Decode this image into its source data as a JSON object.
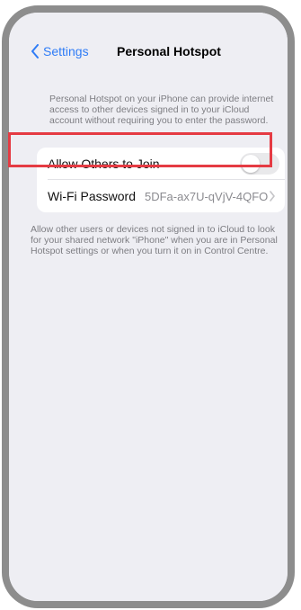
{
  "nav": {
    "back_label": "Settings",
    "title": "Personal Hotspot"
  },
  "header_note": "Personal Hotspot on your iPhone can provide internet access to other devices signed in to your iCloud account without requiring you to enter the password.",
  "rows": [
    {
      "label": "Allow Others to Join",
      "toggle_on": false
    },
    {
      "label": "Wi-Fi Password",
      "value": "5DFa-ax7U-qVjV-4QFO"
    }
  ],
  "footer_note": "Allow other users or devices not signed in to iCloud to look for your shared network \"iPhone\" when you are in Personal Hotspot settings or when you turn it on in Control Centre.",
  "icons": {
    "back": "chevron-left-icon",
    "disclosure": "chevron-right-icon"
  },
  "colors": {
    "accent": "#2f7cf6",
    "background": "#eeeef3",
    "highlight": "#e53b43",
    "toggle_off": "#e9e9eb"
  }
}
